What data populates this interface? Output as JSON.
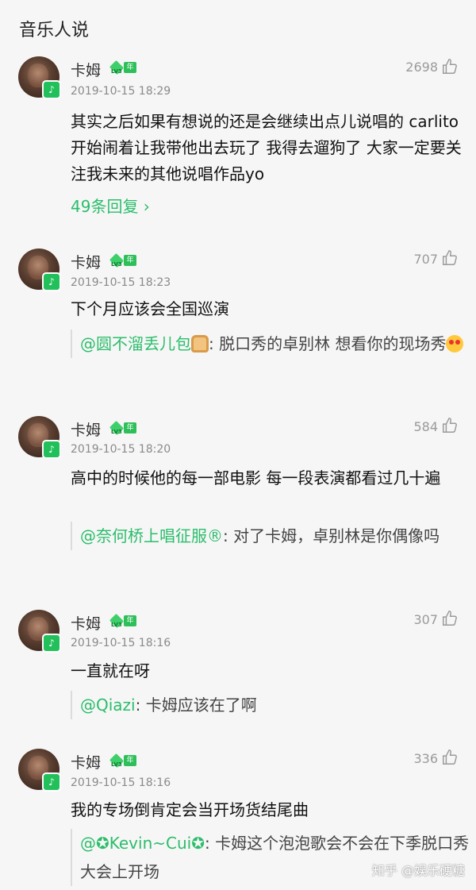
{
  "header": {
    "title": "音乐人说"
  },
  "user": {
    "name": "卡姆",
    "badge_year_label": "年",
    "badge_level_label": "LV3"
  },
  "colors": {
    "accent_green": "#2bbd6b",
    "meta_gray": "#8a8a8a",
    "background": "#f6f6f6"
  },
  "comments": [
    {
      "timestamp": "2019-10-15 18:29",
      "likes": "2698",
      "text": "其实之后如果有想说的还是会继续出点儿说唱的 carlito开始闹着让我带他出去玩了 我得去遛狗了 大家一定要关注我未来的其他说唱作品yo",
      "replies_link": "49条回复 ›"
    },
    {
      "timestamp": "2019-10-15 18:23",
      "likes": "707",
      "text": "下个月应该会全国巡演",
      "quote": {
        "mention": "@圆不溜丢儿包",
        "emoji": "bread-emoji",
        "text": ": 脱口秀的卓别林 想看你的现场秀",
        "trailing_emoji": "heart-eyes-emoji"
      }
    },
    {
      "timestamp": "2019-10-15 18:20",
      "likes": "584",
      "text": "高中的时候他的每一部电影 每一段表演都看过几十遍",
      "quote": {
        "mention": "@奈何桥上唱征服®",
        "text": ": 对了卡姆，卓别林是你偶像吗"
      }
    },
    {
      "timestamp": "2019-10-15 18:16",
      "likes": "307",
      "text": "一直就在呀",
      "quote": {
        "mention": "@Qiazi",
        "text": ": 卡姆应该在了啊"
      }
    },
    {
      "timestamp": "2019-10-15 18:16",
      "likes": "336",
      "text": "我的专场倒肯定会当开场货结尾曲",
      "quote": {
        "mention": "@✪Kevin~Cui✪",
        "text": ": 卡姆这个泡泡歌会不会在下季脱口秀大会上开场"
      }
    }
  ],
  "watermark": "知乎 @娱乐硬糖"
}
